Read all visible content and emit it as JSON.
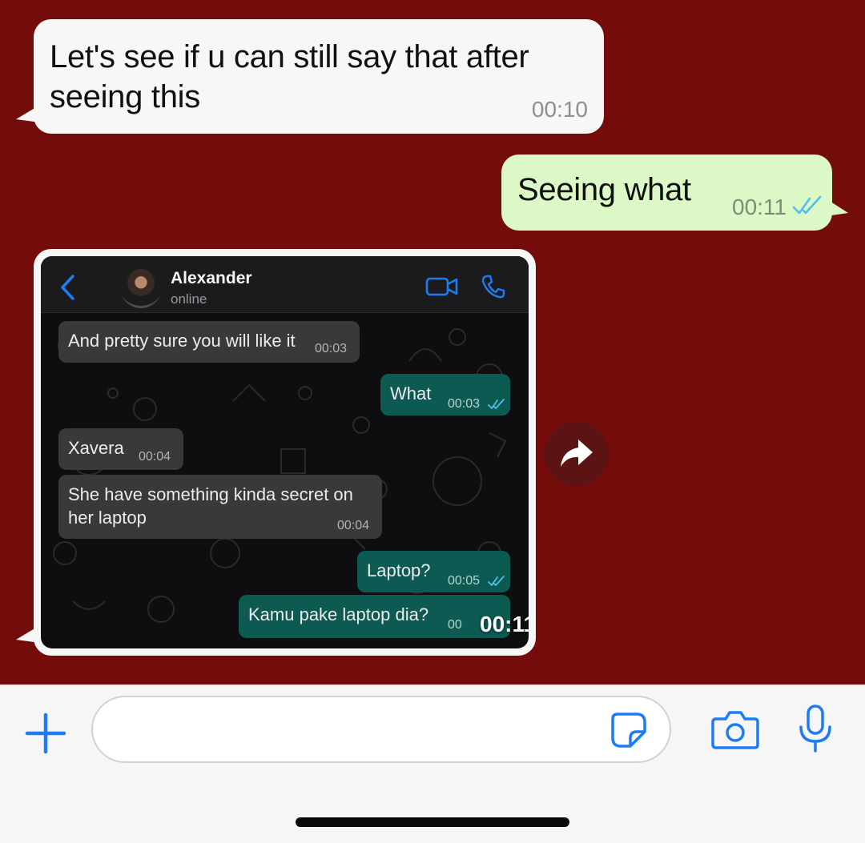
{
  "messages": [
    {
      "text": "Let's see if u can still say that after seeing this",
      "time": "00:10"
    },
    {
      "text": "Seeing what",
      "time": "00:11"
    }
  ],
  "image_message": {
    "time_overlay": "00:11",
    "screenshot": {
      "contact_name": "Alexander",
      "contact_status": "online",
      "bubbles": [
        {
          "text": "And pretty sure you will like it",
          "time": "00:03"
        },
        {
          "text": "What",
          "time": "00:03"
        },
        {
          "text": "Xavera",
          "time": "00:04"
        },
        {
          "text_line1": "She have something kinda secret on",
          "text_line2": "her laptop",
          "time": "00:04"
        },
        {
          "text": "Laptop?",
          "time": "00:05"
        },
        {
          "text": "Kamu pake laptop dia?",
          "time": "00"
        }
      ]
    }
  },
  "colors": {
    "chat_background": "#740c0c",
    "incoming_bubble": "#f7f7f7",
    "outgoing_bubble": "#dcf8c6",
    "accent_blue": "#1e7cf0",
    "read_ticks": "#53bdeb"
  },
  "icons": {
    "forward": "forward-arrow-icon",
    "add": "plus-icon",
    "sticker": "sticker-icon",
    "camera": "camera-icon",
    "mic": "microphone-icon"
  }
}
